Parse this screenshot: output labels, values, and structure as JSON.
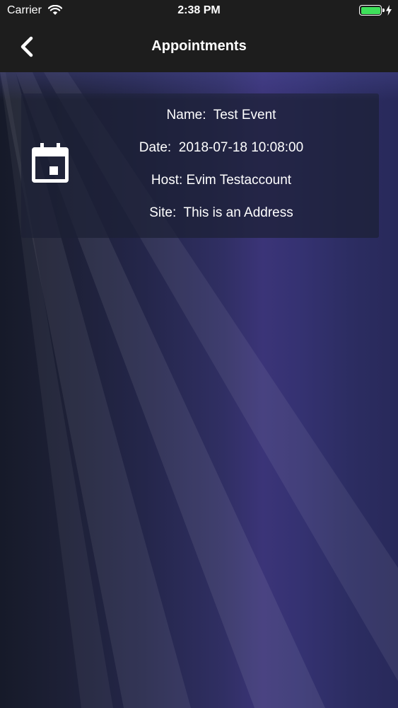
{
  "status_bar": {
    "carrier": "Carrier",
    "time": "2:38 PM",
    "battery_level": 1.0,
    "battery_color": "#3ee05a"
  },
  "nav": {
    "title": "Appointments",
    "back_icon": "chevron-left-icon"
  },
  "appointment": {
    "icon": "calendar-icon",
    "name_line": "Name:  Test Event",
    "date_line": "Date:  2018-07-18 10:08:00",
    "host_line": "Host: Evim Testaccount",
    "site_line": "Site:  This is an Address"
  },
  "colors": {
    "bar_background": "#1d1d1d",
    "text": "#ffffff"
  }
}
